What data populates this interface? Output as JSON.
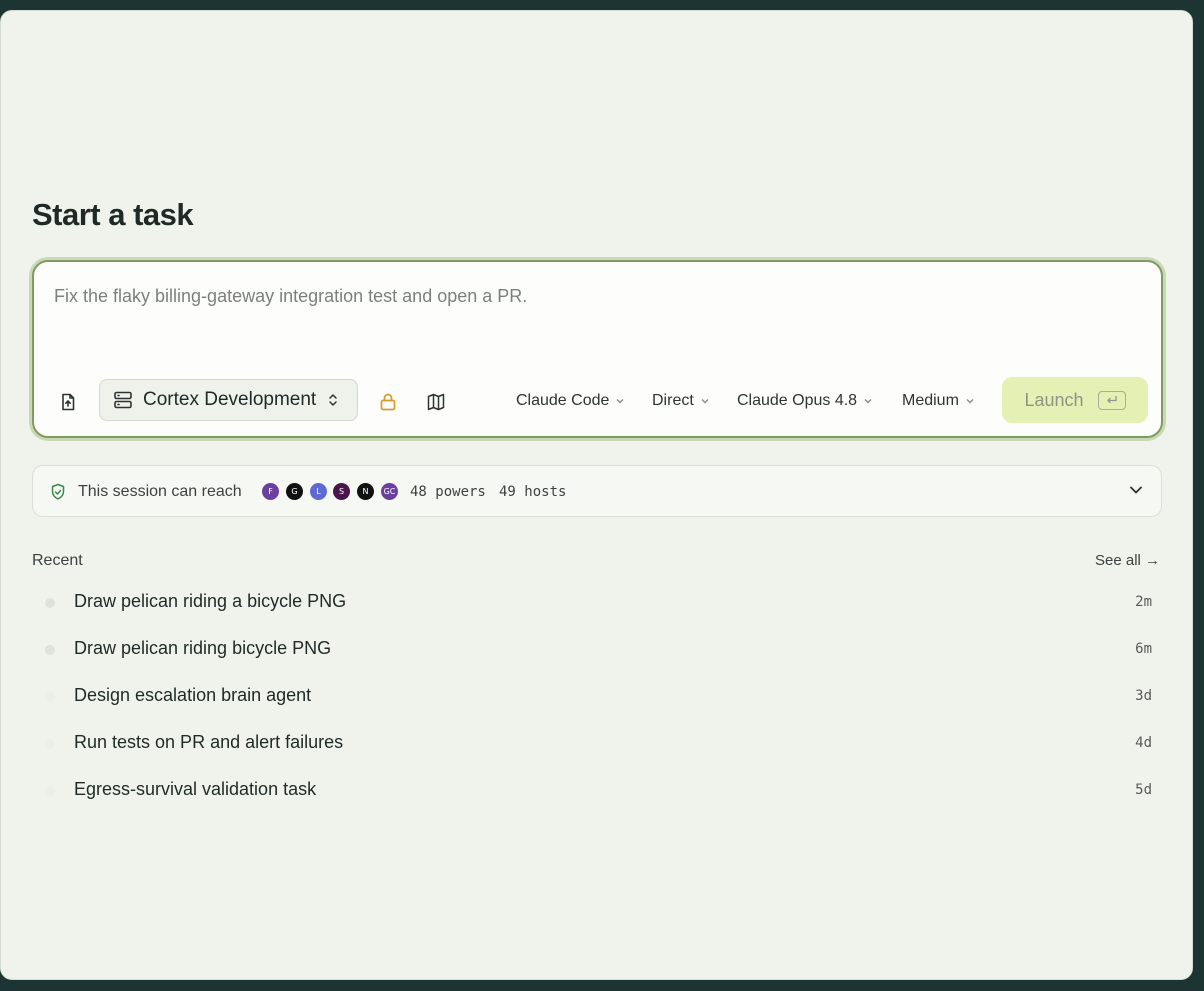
{
  "page": {
    "title": "Start a task"
  },
  "composer": {
    "prompt": "Fix the flaky billing-gateway integration test and open a PR.",
    "environment": "Cortex Development",
    "dropdowns": [
      "Claude Code",
      "Direct",
      "Claude Opus 4.8",
      "Medium"
    ],
    "launch_label": "Launch"
  },
  "reach": {
    "label": "This session can reach",
    "powers": "48 powers",
    "hosts": "49 hosts",
    "integrations": [
      {
        "icon": "figma-icon",
        "color": "#6b3fa0",
        "text": "F"
      },
      {
        "icon": "github-icon",
        "color": "#111111",
        "text": "G"
      },
      {
        "icon": "linear-icon",
        "color": "#5e6ad2",
        "text": "L"
      },
      {
        "icon": "slack-icon",
        "color": "#4a154b",
        "text": "S"
      },
      {
        "icon": "notion-icon",
        "color": "#111111",
        "text": "N"
      },
      {
        "icon": "gc-icon",
        "color": "#6b3fa0",
        "text": "GC"
      }
    ]
  },
  "recent": {
    "heading": "Recent",
    "see_all": "See all →",
    "items": [
      {
        "label": "Draw pelican riding a bicycle PNG",
        "time": "2m",
        "active": true
      },
      {
        "label": "Draw pelican riding bicycle PNG",
        "time": "6m",
        "active": true
      },
      {
        "label": "Design escalation brain agent",
        "time": "3d",
        "active": false
      },
      {
        "label": "Run tests on PR and alert failures",
        "time": "4d",
        "active": false
      },
      {
        "label": "Egress-survival validation task",
        "time": "5d",
        "active": false
      }
    ]
  },
  "colors": {
    "accent": "#7f9b61",
    "launch_bg": "#e4f0b4",
    "lock": "#d69a2d",
    "shield": "#3a8a4a",
    "active_dot": "#dfe3d7"
  }
}
